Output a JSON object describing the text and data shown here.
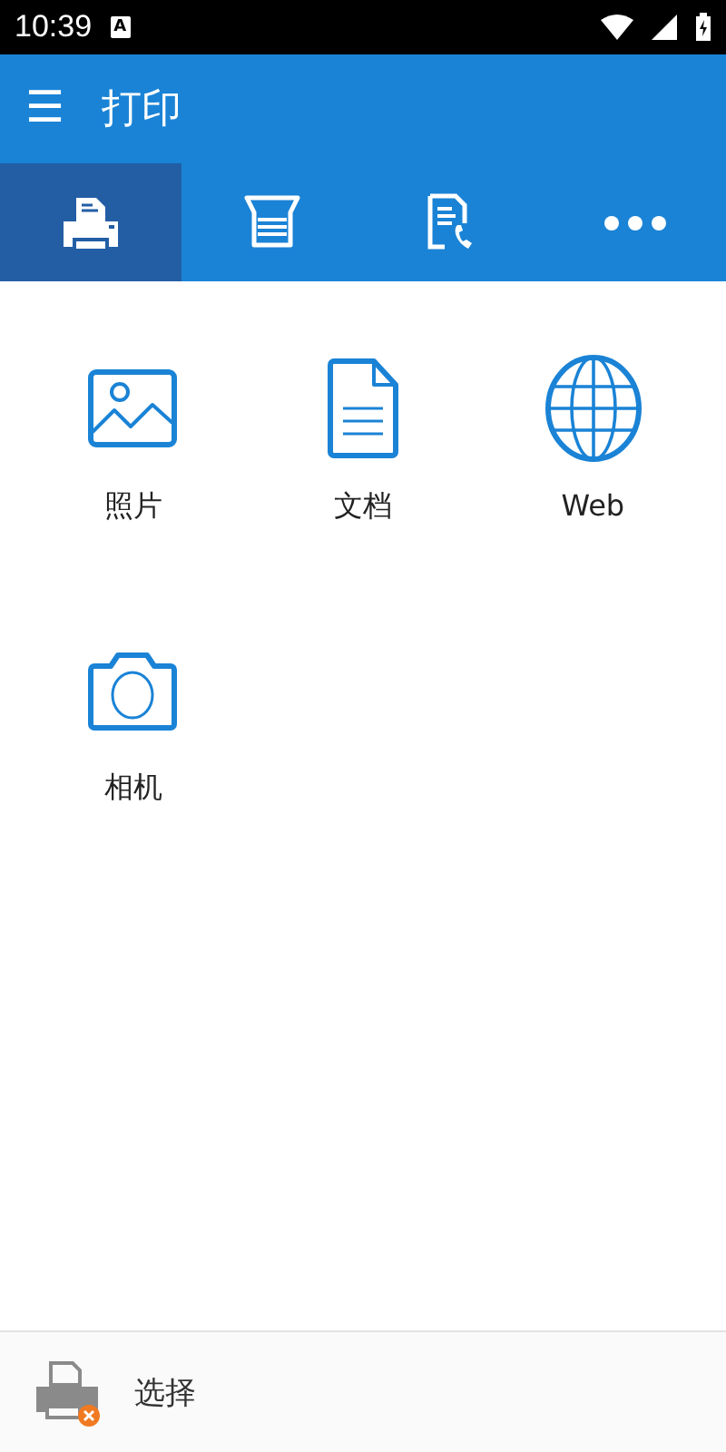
{
  "status_bar": {
    "time": "10:39",
    "notification_glyph": "A"
  },
  "app_bar": {
    "menu_glyph": "☰",
    "title": "打印"
  },
  "tabs": [
    {
      "kind": "print",
      "selected": true
    },
    {
      "kind": "scan",
      "selected": false
    },
    {
      "kind": "fax",
      "selected": false
    },
    {
      "kind": "more",
      "selected": false
    }
  ],
  "sources": [
    {
      "kind": "photo",
      "label": "照片"
    },
    {
      "kind": "document",
      "label": "文档"
    },
    {
      "kind": "web",
      "label": "Web"
    },
    {
      "kind": "camera",
      "label": "相机"
    }
  ],
  "printer_bar": {
    "label": "选择",
    "connected": false
  }
}
